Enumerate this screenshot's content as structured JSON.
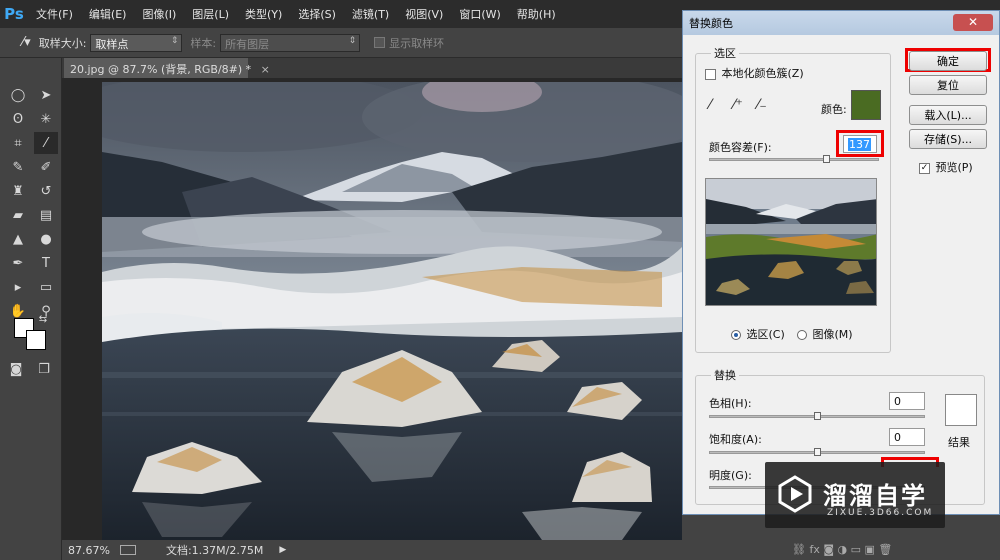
{
  "app": {
    "logo": "Ps",
    "menu": [
      "文件(F)",
      "编辑(E)",
      "图像(I)",
      "图层(L)",
      "类型(Y)",
      "选择(S)",
      "滤镜(T)",
      "视图(V)",
      "窗口(W)",
      "帮助(H)"
    ]
  },
  "options": {
    "sample_size_label": "取样大小:",
    "sample_size_value": "取样点",
    "sample_label": "样本:",
    "sample_value": "所有图层",
    "show_ring_label": "显示取样环"
  },
  "document": {
    "tab_title": "20.jpg @ 87.7% (背景, RGB/8#) *",
    "tab_close": "×"
  },
  "status": {
    "zoom": "87.67%",
    "doc_info": "文档:1.37M/2.75M"
  },
  "dialog": {
    "title": "替换颜色",
    "selection_group": "选区",
    "localized_clusters": "本地化颜色簇(Z)",
    "color_label": "颜色:",
    "color_swatch": "#4a6b22",
    "tolerance_label": "颜色容差(F):",
    "tolerance_value": "137",
    "tolerance_fraction": 0.69,
    "radio_selection": "选区(C)",
    "radio_image": "图像(M)",
    "replace_group": "替换",
    "hue_label": "色相(H):",
    "hue_value": "0",
    "saturation_label": "饱和度(A):",
    "saturation_value": "0",
    "lightness_label": "明度(G):",
    "result_label": "结果",
    "result_swatch": "#ffffff",
    "buttons": {
      "ok": "确定",
      "reset": "复位",
      "load": "载入(L)...",
      "save": "存储(S)...",
      "preview": "预览(P)"
    },
    "close": "✕"
  },
  "watermark": {
    "brand": "溜溜自学",
    "url": "ZIXUE.3D66.COM"
  },
  "colors": {
    "highlight": "#e00000",
    "ps_blue": "#3fa9f5"
  }
}
